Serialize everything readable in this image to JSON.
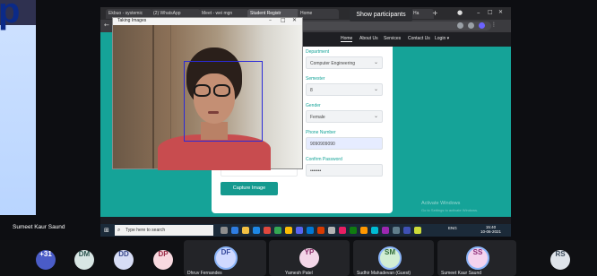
{
  "meet": {
    "show_participants": "Show participants",
    "presenter_name": "Sumeet Kaur Saund",
    "participants": [
      {
        "initials": "+31",
        "bg": "#4a5cc7",
        "fg": "#ffffff"
      },
      {
        "initials": "DM",
        "bg": "#d8e6e4",
        "fg": "#2f5752"
      },
      {
        "initials": "DD",
        "bg": "#d7ddf5",
        "fg": "#3a4a8c"
      },
      {
        "initials": "DP",
        "bg": "#f8d9e0",
        "fg": "#9b2c47"
      },
      {
        "initials": "DF",
        "bg": "#cfd9ff",
        "fg": "#34489b",
        "label": "Dhruv Fernandes"
      },
      {
        "initials": "YP",
        "bg": "#f3d6e8",
        "fg": "#8b2e6a",
        "label": "Yamesh Patel"
      },
      {
        "initials": "SM",
        "bg": "#d2eed4",
        "fg": "#2f6a37",
        "label": "Sudhir Mahadevan (Guest)"
      },
      {
        "initials": "SS",
        "bg": "#f4d3ee",
        "fg": "#8c2a76",
        "label": "Sumeet Kaur Saund"
      },
      {
        "initials": "RS",
        "bg": "#dfe4ea",
        "fg": "#3b4a59"
      }
    ]
  },
  "browser": {
    "tabs": [
      "Ekbuo - systemic",
      "(2) WhatsApp",
      "Meet - wei mgn",
      "Student Registr",
      "Home",
      "Ha"
    ]
  },
  "site": {
    "nav": [
      "Home",
      "About Us",
      "Services",
      "Contact Us",
      "Login ▾"
    ],
    "form": {
      "department_label": "Department",
      "department_value": "Computer Engineering",
      "semester_label": "Semester",
      "semester_value": "8",
      "gender_label": "Gender",
      "gender_value": "Female",
      "phone_label": "Phone Number",
      "phone_value": "9090909090",
      "confirm_label": "Confirm Password",
      "confirm_value": "•••••••",
      "capture_button": "Capture Image"
    }
  },
  "camera_window": {
    "title": "Taking Images"
  },
  "taskbar": {
    "search_placeholder": "Type here to search",
    "tray": "ENG",
    "time": "15:40",
    "date": "10-06-2021"
  },
  "watermark": {
    "title": "Activate Windows",
    "subtitle": "Go to Settings to activate Windows."
  }
}
